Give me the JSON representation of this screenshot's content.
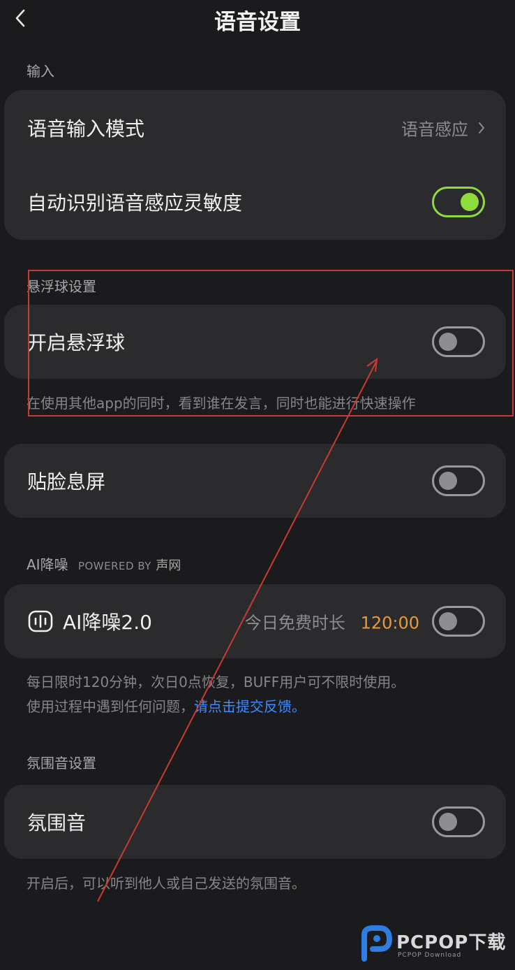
{
  "header": {
    "title": "语音设置",
    "back_icon": "chevron-left-icon"
  },
  "sections": {
    "input": {
      "label": "输入",
      "rows": [
        {
          "label": "语音输入模式",
          "value": "语音感应"
        },
        {
          "label": "自动识别语音感应灵敏度",
          "toggle": "on"
        }
      ]
    },
    "floating_ball": {
      "label": "悬浮球设置",
      "row_label": "开启悬浮球",
      "toggle": "off",
      "desc": "在使用其他app的同时，看到谁在发言，同时也能进行快速操作"
    },
    "face_screen": {
      "row_label": "贴脸息屏",
      "toggle": "off"
    },
    "ai_noise": {
      "label": "AI降噪",
      "powered_by": "POWERED BY",
      "provider": "声网",
      "row_label": "AI降噪2.0",
      "free_label": "今日免费时长",
      "free_time": "120:00",
      "toggle": "off",
      "desc_line1": "每日限时120分钟，次日0点恢复，BUFF用户可不限时使用。",
      "desc_line2_prefix": "使用过程中遇到任何问题，",
      "desc_link": "请点击提交反馈。"
    },
    "ambience": {
      "label": "氛围音设置",
      "row_label": "氛围音",
      "toggle": "off",
      "desc": "开启后，可以听到他人或自己发送的氛围音。"
    }
  },
  "watermark": {
    "text": "PCPOP下载",
    "sub": "PCPOP Download"
  },
  "colors": {
    "accent_green": "#8edb3e",
    "link_blue": "#3d8cff",
    "timer_orange": "#e89a3a",
    "annotation_red": "#c83b32"
  }
}
